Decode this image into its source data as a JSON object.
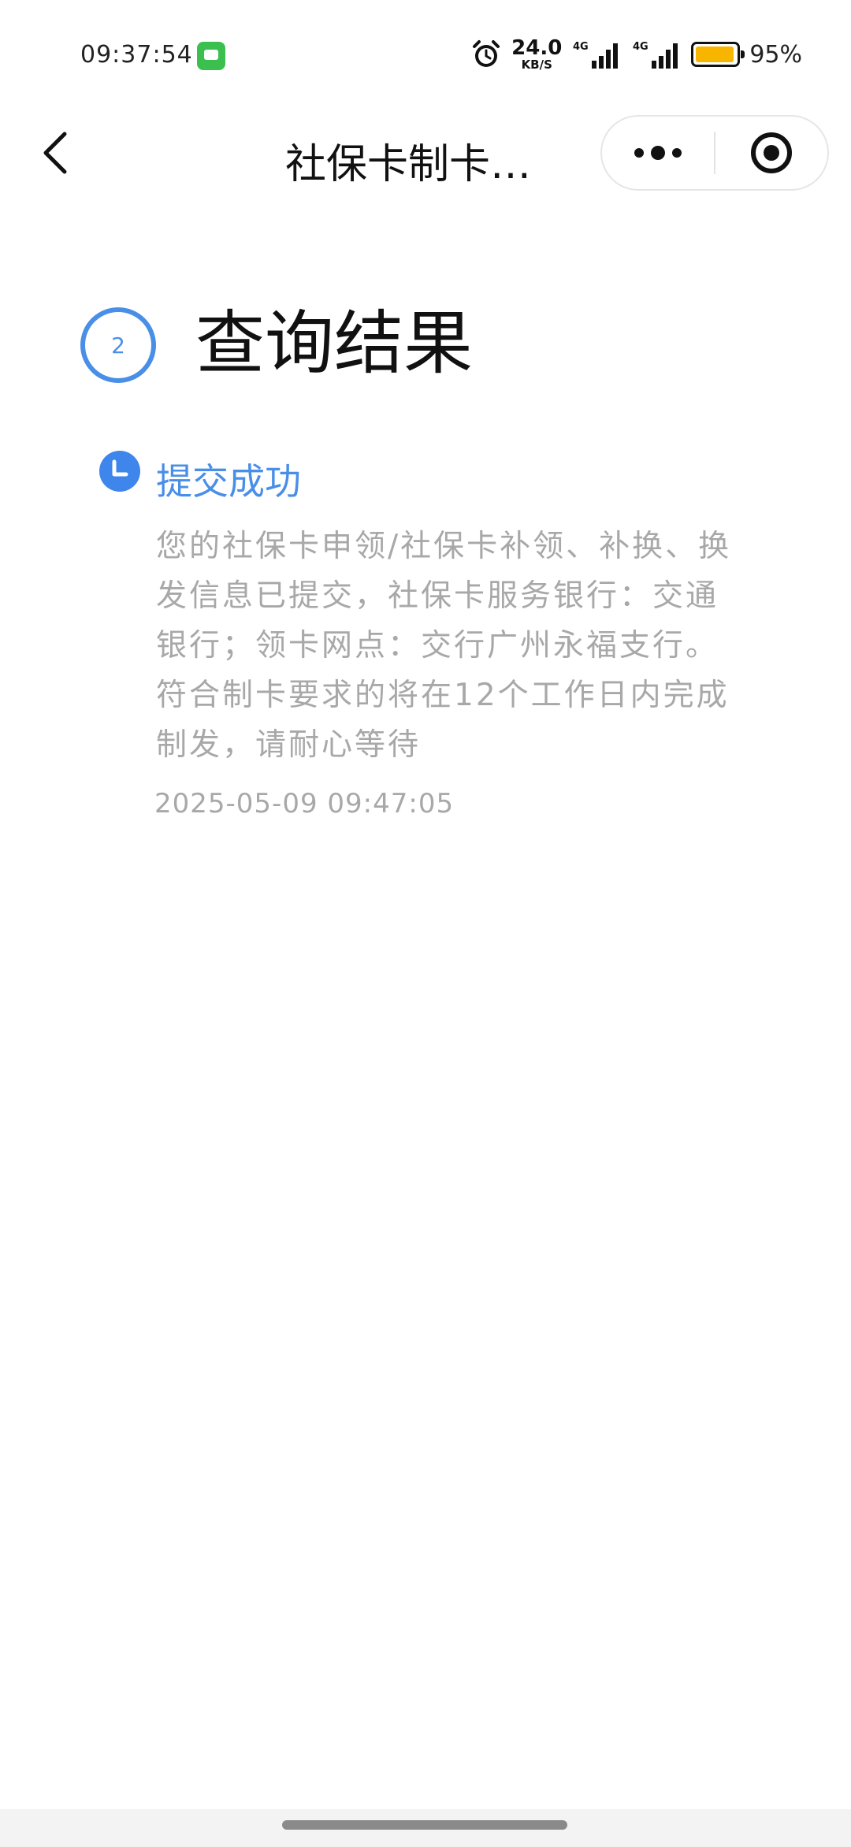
{
  "status_bar": {
    "time": "09:37:54",
    "net_speed_value": "24.0",
    "net_speed_unit": "KB/S",
    "network_1": "4G",
    "network_2": "4G",
    "battery_percent": "95%",
    "battery_level": 0.95,
    "icons": [
      "message-icon",
      "alarm-icon",
      "signal-icon",
      "battery-icon"
    ]
  },
  "nav": {
    "title": "社保卡制卡…",
    "icons": [
      "back-arrow-icon",
      "more-icon",
      "target-icon"
    ]
  },
  "step": {
    "number": "2",
    "title": "查询结果"
  },
  "result": {
    "title": "提交成功",
    "description": "您的社保卡申领/社保卡补领、补换、换发信息已提交，社保卡服务银行：交通银行；领卡网点：交行广州永福支行。符合制卡要求的将在12个工作日内完成制发，请耐心等待",
    "datetime": "2025-05-09  09:47:05",
    "icon": "clock-icon"
  },
  "colors": {
    "accent": "#4a8fe7",
    "muted_text": "#a8a8a8",
    "battery": "#f7b500"
  }
}
